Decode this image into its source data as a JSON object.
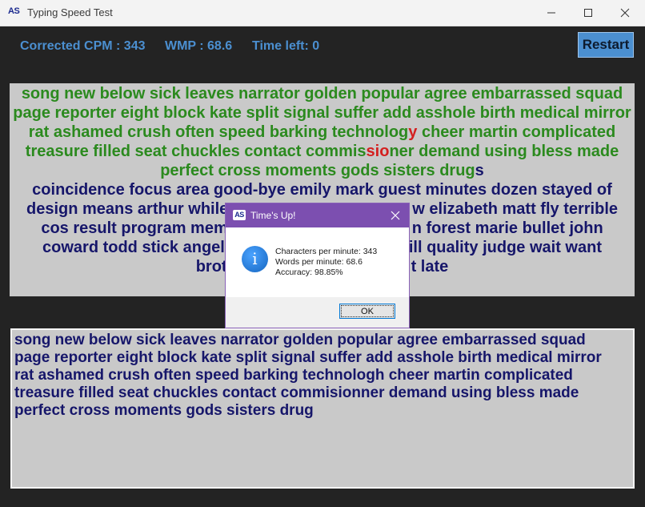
{
  "window": {
    "title": "Typing Speed Test",
    "app_icon_text": "AS"
  },
  "stats": {
    "corrected_cpm": "Corrected CPM : 343",
    "wpm": "WMP : 68.6",
    "time_left": "Time left: 0"
  },
  "restart_label": "Restart",
  "target_text": {
    "typed_correct_1": "song new below sick leaves narrator golden popular agree embarrassed squad page reporter eight block kate split signal suffer add asshole birth medical mirror rat ashamed crush often speed barking technolog",
    "typed_wrong_1": "y",
    "typed_correct_2": " cheer martin complicated treasure filled seat chuckles contact commis",
    "typed_wrong_2": "sio",
    "typed_correct_3": "ner demand using bless made perfect cross moments gods sisters drug",
    "untyped_line1": "s",
    "untyped_line2": "coincidence focus area good-bye emily mark guest minutes dozen stayed of",
    "untyped_line3a": "design means arthur while",
    "untyped_line3b": "w elizabeth matt fly terrible",
    "untyped_line4a": "cos result program mem",
    "untyped_line4b": "n forest marie bullet john",
    "untyped_line5a": "coward todd stick angel",
    "untyped_line5b": "ill quality judge wait want",
    "untyped_line6a": "brot",
    "untyped_line6b": "t late"
  },
  "input_text": "song new below sick leaves narrator golden popular agree embarrassed squad page reporter eight block kate split signal suffer add asshole birth medical mirror rat ashamed crush often speed barking technologh cheer martin complicated treasure filled seat chuckles contact commisionner demand using bless made perfect cross moments gods sisters drug",
  "dialog": {
    "title": "Time's Up!",
    "icon_text": "AS",
    "info_glyph": "i",
    "line1": "Characters per minute: 343",
    "line2": "Words per minute: 68.6",
    "line3": "Accuracy: 98.85%",
    "ok_label": "OK"
  },
  "colors": {
    "correct": "#2b8a1e",
    "wrong": "#d41f1f",
    "untyped": "#16166a",
    "accent": "#4b8fd0",
    "dialog_title": "#7c4fb0"
  }
}
